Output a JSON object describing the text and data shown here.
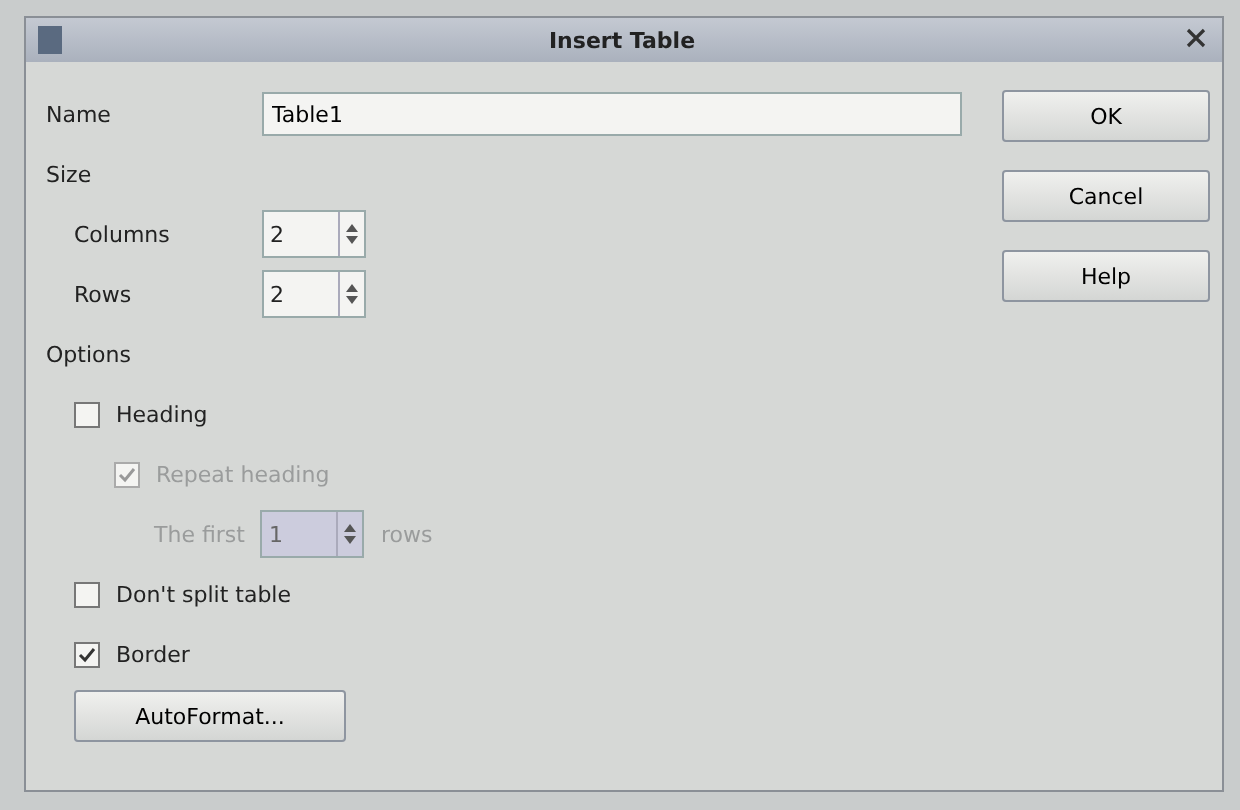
{
  "window": {
    "title": "Insert Table"
  },
  "name": {
    "label": "Name",
    "value": "Table1"
  },
  "size": {
    "title": "Size",
    "fields": [
      {
        "label": "Columns",
        "value": "2"
      },
      {
        "label": "Rows",
        "value": "2"
      }
    ]
  },
  "options": {
    "title": "Options",
    "heading": {
      "label": "Heading",
      "checked": false,
      "disabled": false
    },
    "repeat_heading": {
      "label": "Repeat heading",
      "checked": true,
      "disabled": true
    },
    "first_rows": {
      "label": "The first",
      "value": "1",
      "unit": "rows",
      "disabled": true
    },
    "dont_split": {
      "label": "Don't split table",
      "checked": false,
      "disabled": false
    },
    "border": {
      "label": "Border",
      "checked": true,
      "disabled": false
    },
    "autoformat": "AutoFormat..."
  },
  "buttons": [
    "OK",
    "Cancel",
    "Help"
  ]
}
